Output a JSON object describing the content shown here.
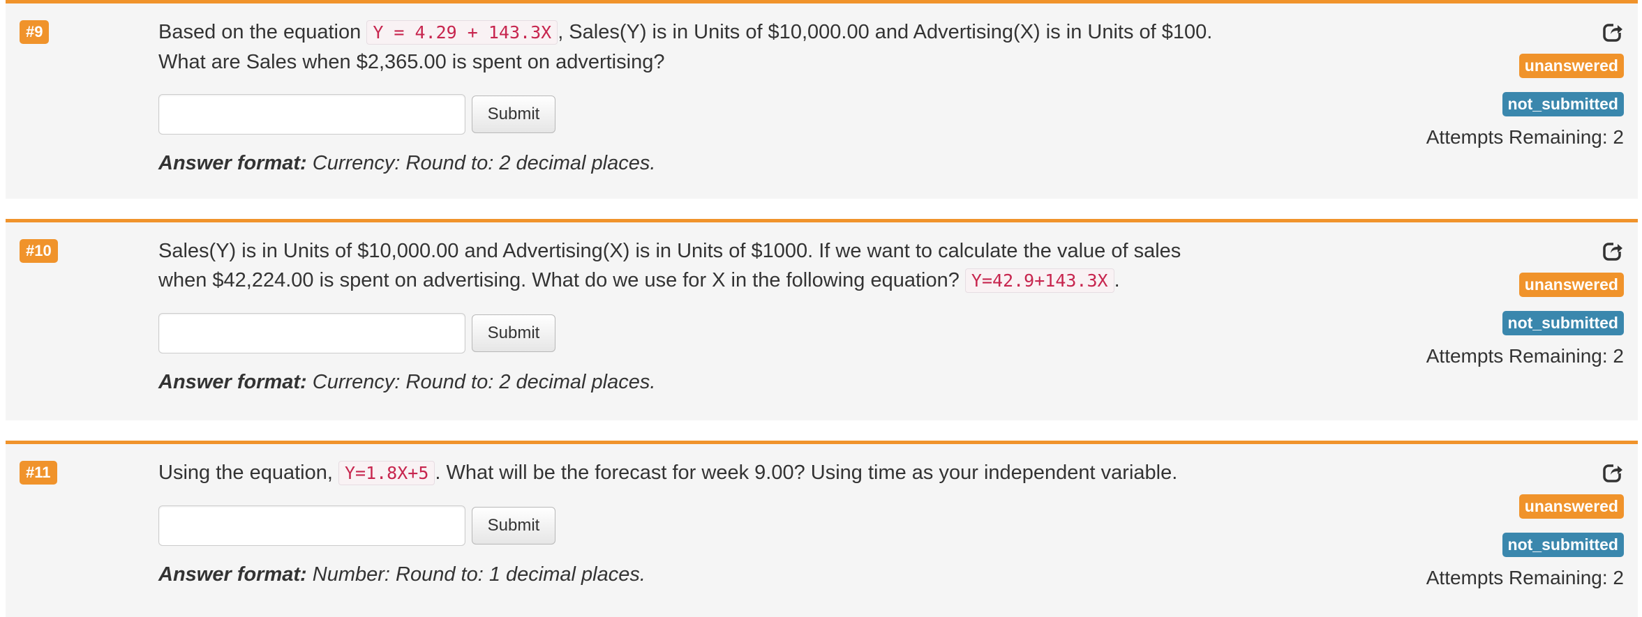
{
  "questions": [
    {
      "number": "#9",
      "text_before": "Based on the equation ",
      "equation": "Y = 4.29 + 143.3X",
      "text_after": ", Sales(Y) is in Units of $10,000.00 and Advertising(X) is in Units of $100. What are Sales when $2,365.00 is spent on advertising?",
      "answer_value": "",
      "submit_label": "Submit",
      "format_label": "Answer format:",
      "format_text": " Currency: Round to: 2 decimal places.",
      "status_badge": "unanswered",
      "submission_badge": "not_submitted",
      "attempts": "Attempts Remaining: 2"
    },
    {
      "number": "#10",
      "text_before": "Sales(Y) is in Units of $10,000.00 and Advertising(X) is in Units of $1000. If we want to calculate the value of sales when $42,224.00 is spent on advertising. What do we use for X in the following equation? ",
      "equation": "Y=42.9+143.3X",
      "text_after": ".",
      "answer_value": "",
      "submit_label": "Submit",
      "format_label": "Answer format:",
      "format_text": " Currency: Round to: 2 decimal places.",
      "status_badge": "unanswered",
      "submission_badge": "not_submitted",
      "attempts": "Attempts Remaining: 2"
    },
    {
      "number": "#11",
      "text_before": "Using the equation, ",
      "equation": "Y=1.8X+5",
      "text_after": ". What will be the forecast for week 9.00? Using time as your independent variable.",
      "answer_value": "",
      "submit_label": "Submit",
      "format_label": "Answer format:",
      "format_text": " Number: Round to: 1 decimal places.",
      "status_badge": "unanswered",
      "submission_badge": "not_submitted",
      "attempts": "Attempts Remaining: 2"
    }
  ],
  "icons": {
    "refresh": "share-arrow-icon"
  },
  "colors": {
    "accent": "#f0932b",
    "info": "#3a87ad",
    "code": "#c7254e",
    "panel": "#f5f5f5"
  }
}
